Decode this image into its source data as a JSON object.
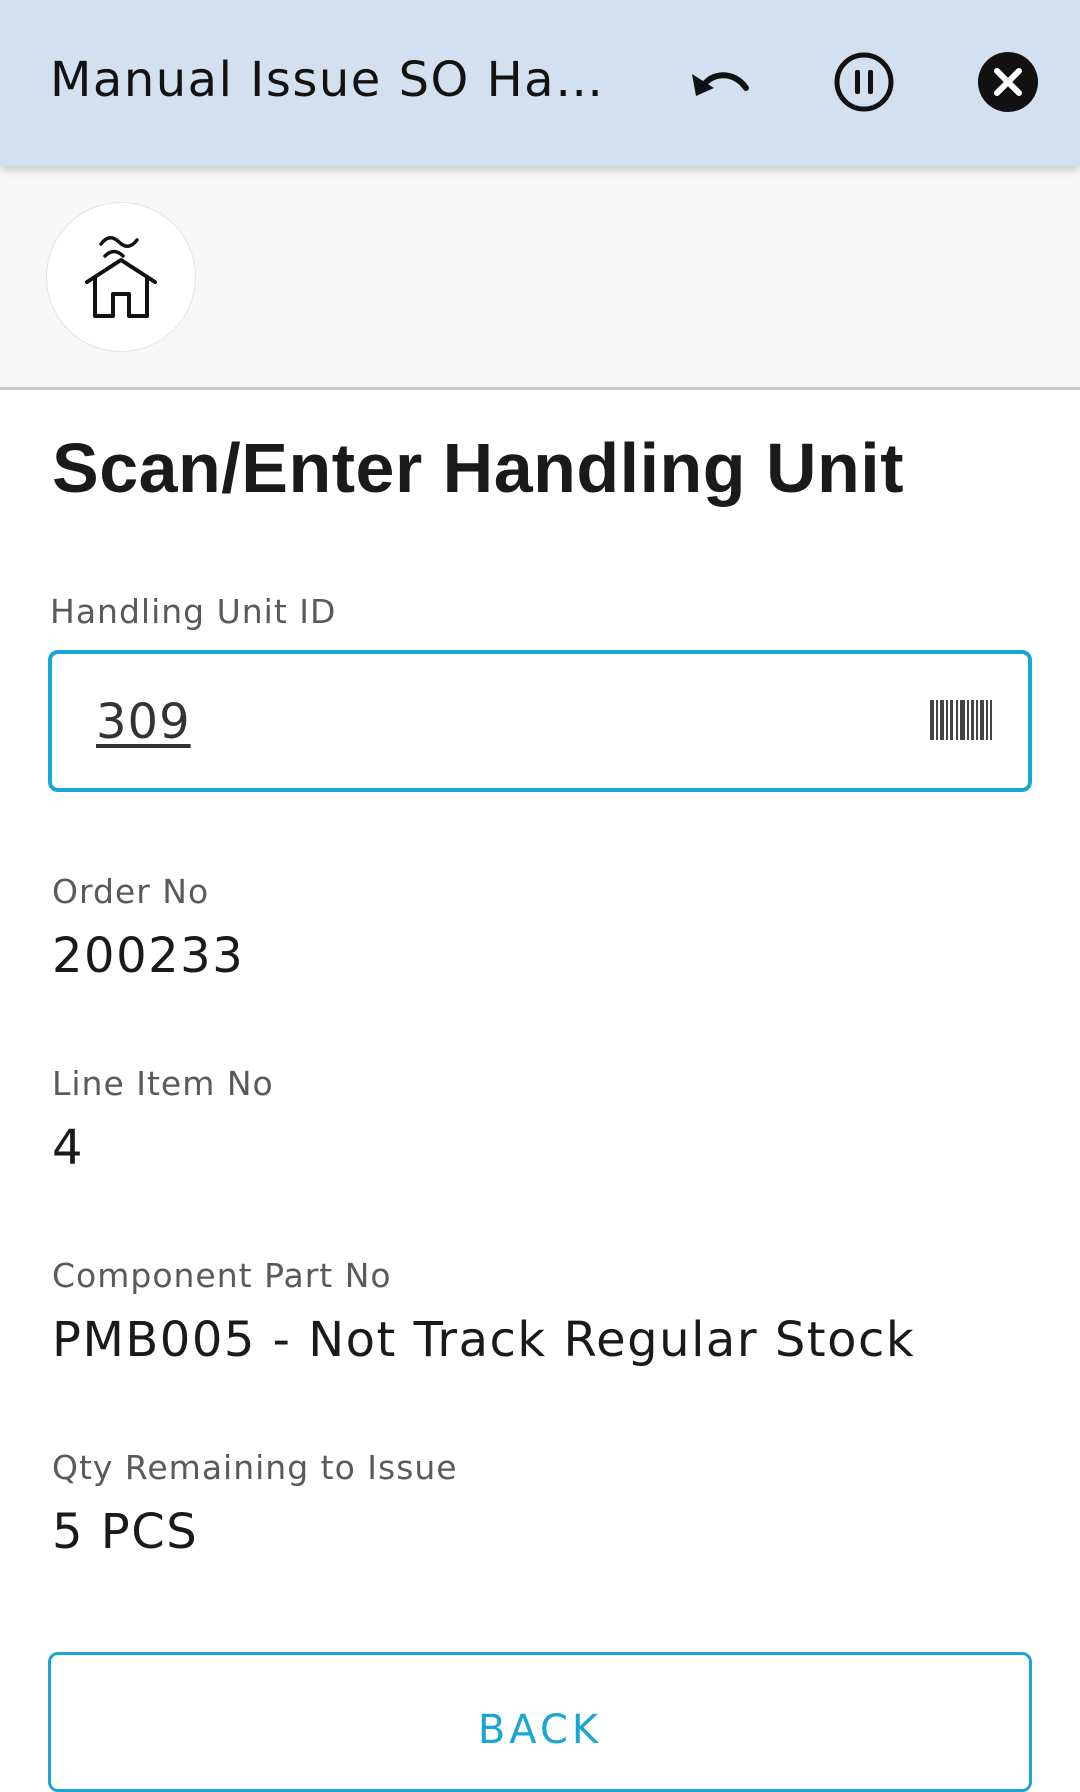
{
  "header": {
    "title": "Manual Issue SO Handling Unit",
    "icons": {
      "undo": "undo-icon",
      "pause": "pause-icon",
      "close": "close-icon"
    }
  },
  "toolbar": {
    "home_icon": "home-icon"
  },
  "main": {
    "title": "Scan/Enter Handling Unit",
    "handling_unit": {
      "label": "Handling Unit ID",
      "value": "309",
      "scan_icon": "barcode-icon"
    },
    "fields": [
      {
        "label": "Order No",
        "value": "200233"
      },
      {
        "label": "Line Item No",
        "value": "4"
      },
      {
        "label": "Component Part No",
        "value": "PMB005 - Not Track Regular Stock"
      },
      {
        "label": "Qty Remaining to Issue",
        "value": "5 PCS"
      }
    ],
    "back_label": "BACK"
  },
  "colors": {
    "header_bg": "#d3e0ef",
    "accent": "#1aa6d4",
    "toolbar_bg": "#f7f7f7"
  }
}
